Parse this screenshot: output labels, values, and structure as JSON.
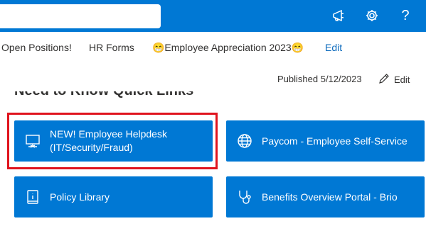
{
  "header": {
    "search_placeholder": "",
    "icons": [
      "megaphone-icon",
      "gear-icon",
      "help-icon"
    ],
    "help_label": "?"
  },
  "nav": {
    "items": [
      {
        "label": "Open Positions!"
      },
      {
        "label": "HR Forms"
      },
      {
        "label": "😁Employee Appreciation 2023😁"
      }
    ],
    "edit_label": "Edit"
  },
  "page": {
    "published": "Published 5/12/2023",
    "edit_label": "Edit",
    "section_title": "Need to Know Quick Links"
  },
  "quick_links": [
    {
      "line1": "NEW! Employee Helpdesk",
      "line2": "(IT/Security/Fraud)",
      "icon": "helpdesk-icon",
      "highlighted": true
    },
    {
      "line1": "Paycom - Employee Self-Service",
      "line2": "",
      "icon": "globe-icon"
    },
    {
      "line1": "Policy Library",
      "line2": "",
      "icon": "book-icon"
    },
    {
      "line1": "Benefits Overview Portal - Brio",
      "line2": "",
      "icon": "stethoscope-icon"
    }
  ],
  "colors": {
    "brand": "#0078d4",
    "highlight": "#e0141e"
  }
}
